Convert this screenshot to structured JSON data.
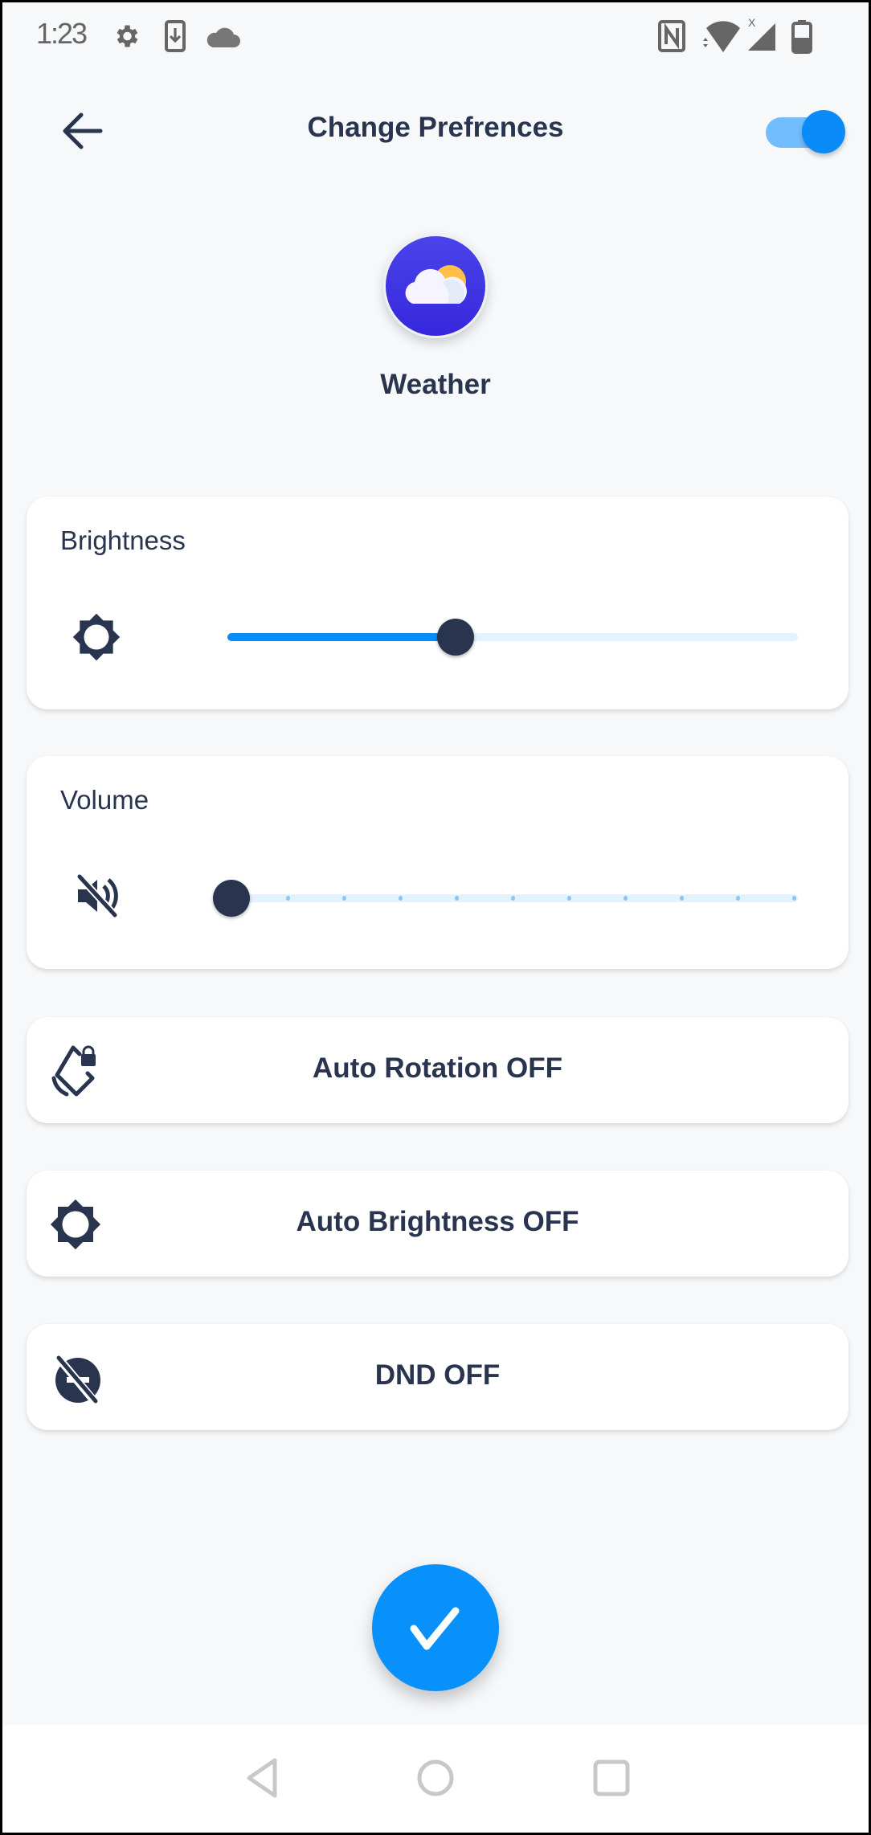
{
  "status_bar": {
    "time": "1:23",
    "left_icons": [
      "settings-gear-icon",
      "download-icon",
      "cloud-icon"
    ],
    "right_icons": [
      "nfc-icon",
      "wifi-icon",
      "cell-signal-icon",
      "battery-icon"
    ]
  },
  "header": {
    "back_icon": "arrow-left-icon",
    "title": "Change Prefrences",
    "toggle_on": true
  },
  "app": {
    "name": "Weather",
    "icon": "weather-partly-cloudy-icon"
  },
  "brightness": {
    "title": "Brightness",
    "icon": "brightness-icon",
    "value_fraction": 0.4
  },
  "volume": {
    "title": "Volume",
    "icon": "volume-off-icon",
    "value": 0,
    "steps": 10
  },
  "toggles": [
    {
      "label": "Auto Rotation OFF",
      "icon": "screen-rotation-lock-icon"
    },
    {
      "label": "Auto Brightness OFF",
      "icon": "brightness-icon"
    },
    {
      "label": "DND OFF",
      "icon": "dnd-off-icon"
    }
  ],
  "fab": {
    "icon": "check-icon"
  },
  "nav_bar": {
    "buttons": [
      "back-triangle-icon",
      "home-circle-icon",
      "recents-square-icon"
    ]
  },
  "colors": {
    "accent": "#0891fb",
    "text": "#29344f",
    "background": "#f6f8fa",
    "toggle_track": "#72bdfd",
    "app_icon_bg": "#3f36e4",
    "sun": "#ffc04a"
  }
}
